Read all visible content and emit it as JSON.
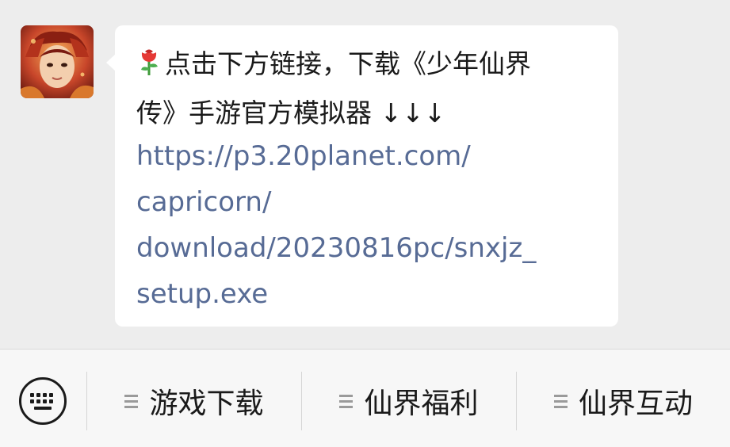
{
  "message": {
    "text_line_1": "点击下方链接，下载《少年仙界",
    "text_line_2": "传》手游官方模拟器 ↓↓↓",
    "link_lines": [
      "https://p3.20planet.com/",
      "capricorn/",
      "download/20230816pc/snxjz_",
      "setup.exe"
    ],
    "link_color": "#576b95"
  },
  "menu": {
    "keyboard_icon": "keyboard-icon",
    "items": [
      {
        "label": "游戏下载",
        "icon": "menu-lines-icon"
      },
      {
        "label": "仙界福利",
        "icon": "menu-lines-icon"
      },
      {
        "label": "仙界互动",
        "icon": "menu-lines-icon"
      }
    ]
  }
}
